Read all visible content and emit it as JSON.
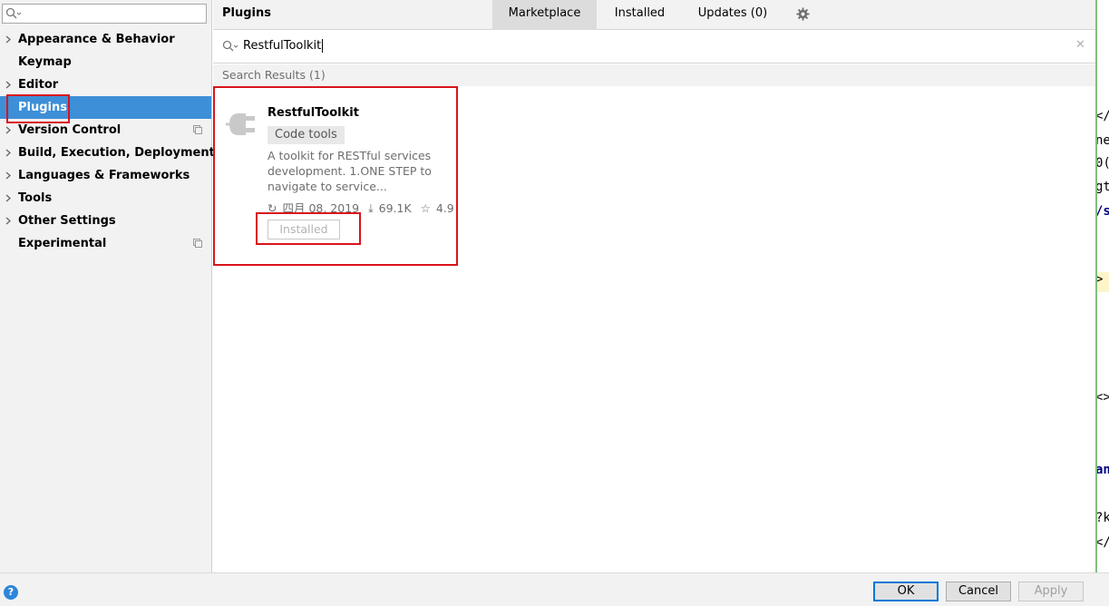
{
  "sidebar": {
    "search_value": "",
    "items": [
      {
        "label": "Appearance & Behavior"
      },
      {
        "label": "Keymap"
      },
      {
        "label": "Editor"
      },
      {
        "label": "Plugins"
      },
      {
        "label": "Version Control"
      },
      {
        "label": "Build, Execution, Deployment"
      },
      {
        "label": "Languages & Frameworks"
      },
      {
        "label": "Tools"
      },
      {
        "label": "Other Settings"
      },
      {
        "label": "Experimental"
      }
    ]
  },
  "header": {
    "title": "Plugins",
    "tabs": [
      {
        "label": "Marketplace"
      },
      {
        "label": "Installed"
      },
      {
        "label": "Updates (0)"
      }
    ]
  },
  "search": {
    "value": "RestfulToolkit"
  },
  "results": {
    "header": "Search Results (1)",
    "plugin": {
      "name": "RestfulToolkit",
      "category": "Code tools",
      "description": "A toolkit for RESTful services development. 1.ONE STEP to navigate to service...",
      "date": "四月 08, 2019",
      "downloads": "69.1K",
      "rating": "4.9",
      "button_label": "Installed"
    }
  },
  "footer": {
    "help": "?",
    "ok": "OK",
    "cancel": "Cancel",
    "apply": "Apply"
  },
  "background_editor": {
    "lines": [
      "</",
      "ne",
      "0(",
      "gt",
      "/s",
      ">",
      "<>",
      "an",
      "?k",
      "</"
    ]
  },
  "colors": {
    "selection": "#3d8fd8",
    "highlight_annotation": "#d9141c",
    "primary_button_border": "#0078d7"
  }
}
